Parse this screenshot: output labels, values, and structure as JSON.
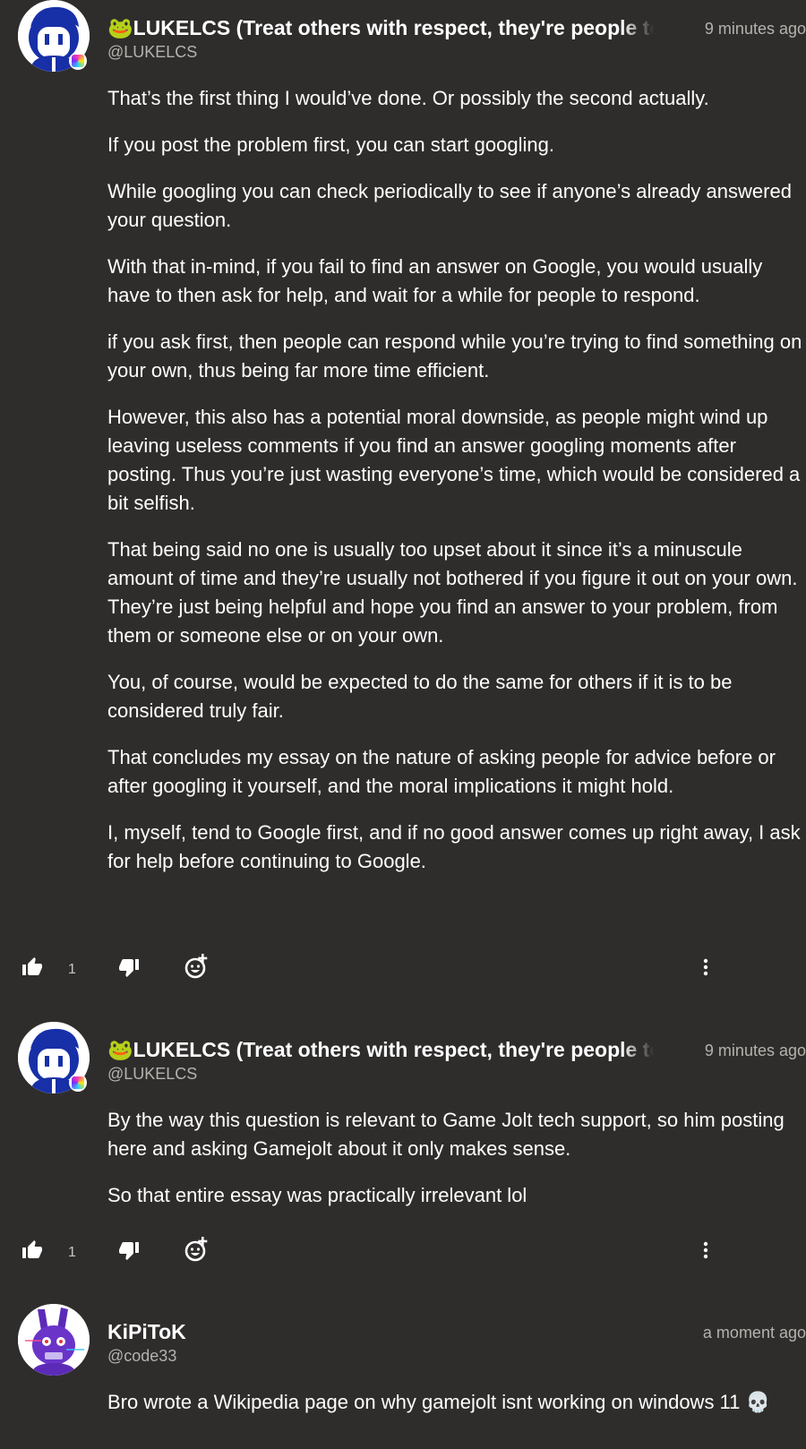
{
  "comments": [
    {
      "name": "🐸LUKELCS (Treat others with respect, they're people too)",
      "handle": "@LUKELCS",
      "time": "9 minutes ago",
      "paragraphs": [
        "That’s the first thing I would’ve done.  Or possibly the second actually.",
        "If you post the problem first, you can start googling.",
        "While googling you can check periodically to see if anyone’s already answered your question.",
        "With that in-mind, if you fail to find an answer on Google, you would usually have to then  ask for help, and wait for a while for people to respond.",
        "if you ask first, then people can respond while you’re trying to find something on your own, thus being far more time efficient.",
        "However, this also has a potential moral downside, as people might wind up leaving useless comments if you find an answer googling moments after posting.  Thus you’re just wasting everyone’s time, which would be considered a bit selfish.",
        "That being said no one is usually too upset about it since it’s a minuscule amount of time and they’re usually not bothered if you figure it out on your own.  They’re just being helpful and hope you find an answer to your problem, from them or someone else or on your own.",
        "You, of course, would be expected to do the same for others if it is to be considered truly fair.",
        "That concludes my essay on the nature of asking people for advice before or after googling it yourself, and the moral implications it might hold.",
        "I, myself, tend to Google first, and if no good answer comes up right away, I ask for help before continuing to Google."
      ],
      "likes": "1"
    },
    {
      "name": "🐸LUKELCS (Treat others with respect, they're people too)",
      "handle": "@LUKELCS",
      "time": "9 minutes ago",
      "paragraphs": [
        "By the way this question is relevant to Game Jolt tech support, so him posting here and asking Gamejolt about it only makes sense.",
        "So that entire essay was practically irrelevant lol"
      ],
      "likes": "1"
    },
    {
      "name": "KiPiToK",
      "handle": "@code33",
      "time": "a moment ago",
      "paragraphs": [
        "Bro wrote a Wikipedia page on why gamejolt isnt working on windows 11 💀"
      ]
    }
  ],
  "icons": [
    "thumbs-up-icon",
    "thumbs-down-icon",
    "add-reaction-icon",
    "more-options-icon"
  ],
  "colors": {
    "background": "#2f2d2c",
    "text": "#ffffff",
    "muted": "#b5b2ae"
  }
}
